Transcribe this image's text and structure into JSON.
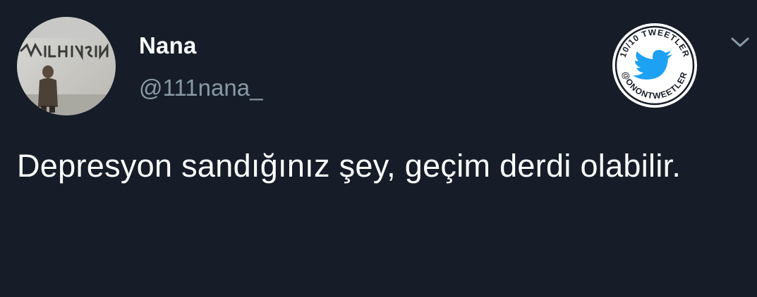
{
  "tweet": {
    "author": {
      "display_name": "Nana",
      "handle": "@111nana_",
      "avatar_icon": "profile-photo"
    },
    "text": "Depresyon sandığınız şey, geçim derdi olabilir.",
    "badge": {
      "top_text": "10/10 TWEETLER",
      "bottom_text": "@ONONTWEETLER",
      "icon": "twitter-bird-icon"
    },
    "menu_icon": "chevron-down-icon"
  },
  "colors": {
    "background": "#161d28",
    "text_primary": "#ffffff",
    "text_secondary": "#8899a6",
    "brand_blue": "#1da1f2"
  }
}
